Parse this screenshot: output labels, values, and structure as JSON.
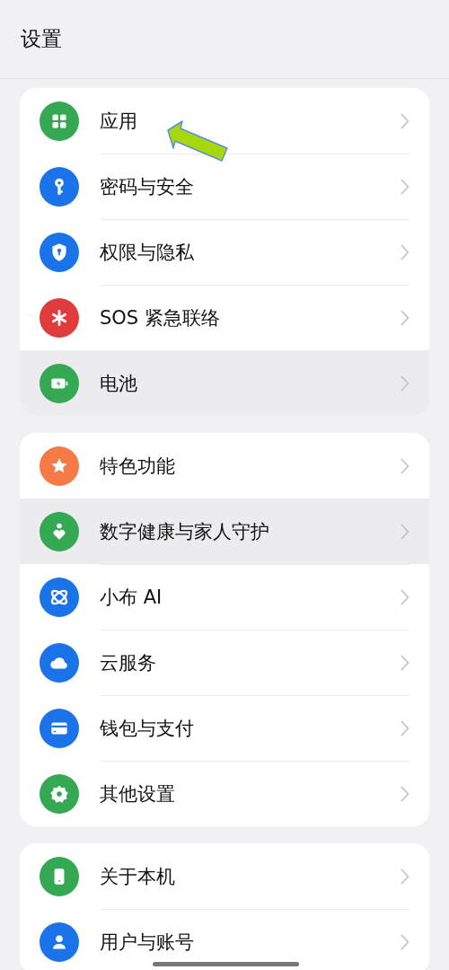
{
  "header": {
    "title": "设置"
  },
  "sections": [
    {
      "items": [
        {
          "label": "应用",
          "color": "#34a853",
          "pressed": false
        },
        {
          "label": "密码与安全",
          "color": "#1a73e8",
          "pressed": false
        },
        {
          "label": "权限与隐私",
          "color": "#1a73e8",
          "pressed": false
        },
        {
          "label": "SOS 紧急联络",
          "color": "#e03c3c",
          "pressed": false
        },
        {
          "label": "电池",
          "color": "#34a853",
          "pressed": true
        }
      ]
    },
    {
      "items": [
        {
          "label": "特色功能",
          "color": "#f57a45",
          "pressed": false
        },
        {
          "label": "数字健康与家人守护",
          "color": "#34a853",
          "pressed": true
        },
        {
          "label": "小布 AI",
          "color": "#1a73e8",
          "pressed": false
        },
        {
          "label": "云服务",
          "color": "#1a73e8",
          "pressed": false
        },
        {
          "label": "钱包与支付",
          "color": "#1a73e8",
          "pressed": false
        },
        {
          "label": "其他设置",
          "color": "#34a853",
          "pressed": false
        }
      ]
    },
    {
      "items": [
        {
          "label": "关于本机",
          "color": "#34a853",
          "pressed": false
        },
        {
          "label": "用户与账号",
          "color": "#1a73e8",
          "pressed": false
        }
      ]
    }
  ]
}
